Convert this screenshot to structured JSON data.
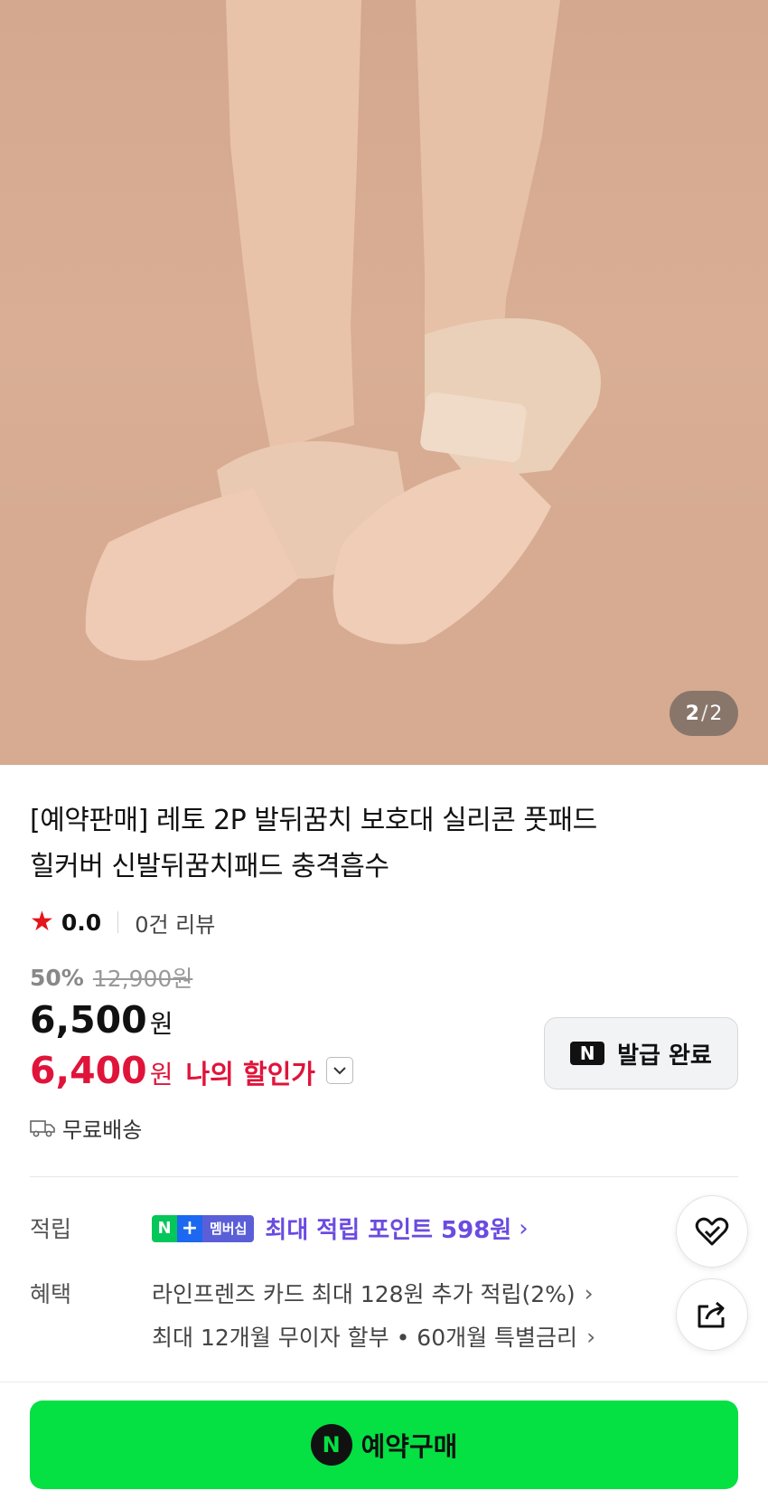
{
  "gallery": {
    "current": "2",
    "separator": "/",
    "total": "2",
    "image_alt_icon": "product-photo-heel-pads"
  },
  "product": {
    "title_line1": "[예약판매] 레토 2P 발뒤꿈치 보호대 실리콘 풋패드",
    "title_line2": "힐커버 신발뒤꿈치패드 충격흡수",
    "rating": "0.0",
    "reviews": "0건 리뷰",
    "discount_percent": "50%",
    "original_price": "12,900원",
    "price": "6,500",
    "price_unit": "원",
    "my_price": "6,400",
    "my_price_unit": "원",
    "my_price_label": "나의 할인가",
    "shipping": "무료배송"
  },
  "coupon": {
    "badge": "N",
    "label": "발급 완료"
  },
  "benefits": {
    "points_label": "적립",
    "membership_badge_n": "N",
    "membership_badge_plus": "+",
    "membership_badge_text": "멤버십",
    "points_text": "최대 적립 포인트 598원",
    "benefit_label": "혜택",
    "benefit_line1": "라인프렌즈 카드 최대 128원 추가 적립(2%)",
    "benefit_line2": "최대 12개월 무이자 할부 • 60개월 특별금리"
  },
  "actions": {
    "buy_badge": "N",
    "buy_label": "예약구매"
  },
  "colors": {
    "accent_red": "#e0143a",
    "naver_green": "#05e043",
    "points_purple": "#6b4be0"
  }
}
